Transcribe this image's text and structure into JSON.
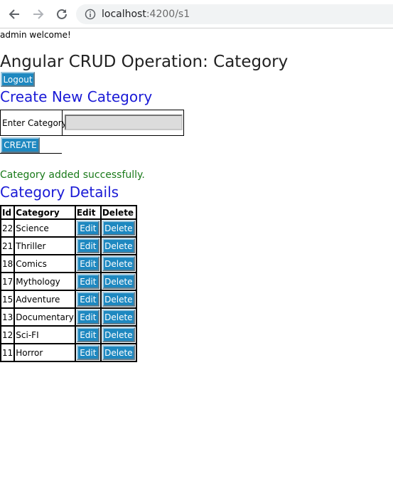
{
  "browser": {
    "url_host": "localhost",
    "url_rest": ":4200/s1"
  },
  "welcome_text": "admin welcome!",
  "app_title": "Angular CRUD Operation: Category",
  "logout_label": "Logout",
  "create": {
    "heading": "Create New Category",
    "label": "Enter Category",
    "input_value": "",
    "button_label": "CREATE"
  },
  "success_message": "Category added successfully.",
  "details": {
    "heading": "Category Details",
    "headers": {
      "id": "Id",
      "category": "Category",
      "edit": "Edit",
      "delete": "Delete"
    },
    "rows": [
      {
        "id": "22",
        "category": "Science",
        "edit": "Edit",
        "delete": "Delete"
      },
      {
        "id": "21",
        "category": "Thriller",
        "edit": "Edit",
        "delete": "Delete"
      },
      {
        "id": "18",
        "category": "Comics",
        "edit": "Edit",
        "delete": "Delete"
      },
      {
        "id": "17",
        "category": "Mythology",
        "edit": "Edit",
        "delete": "Delete"
      },
      {
        "id": "15",
        "category": "Adventure",
        "edit": "Edit",
        "delete": "Delete"
      },
      {
        "id": "13",
        "category": "Documentary",
        "edit": "Edit",
        "delete": "Delete"
      },
      {
        "id": "12",
        "category": "Sci-FI",
        "edit": "Edit",
        "delete": "Delete"
      },
      {
        "id": "11",
        "category": "Horror",
        "edit": "Edit",
        "delete": "Delete"
      }
    ]
  },
  "colors": {
    "button": "#1e88c0",
    "heading": "#1a1ad6",
    "success": "#1a7a1a"
  }
}
